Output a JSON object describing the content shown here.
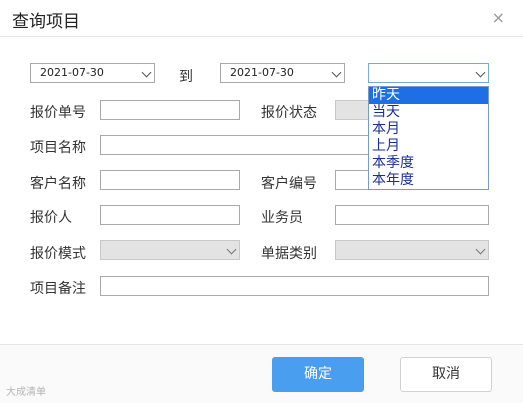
{
  "dialog": {
    "title": "查询项目",
    "close_icon": "×"
  },
  "date_range": {
    "start": "2021-07-30",
    "separator": "到",
    "end": "2021-07-30",
    "period_value": "",
    "period_options": [
      "昨天",
      "当天",
      "本月",
      "上月",
      "本季度",
      "本年度"
    ],
    "highlighted_index": 0
  },
  "fields": {
    "quote_no": "报价单号",
    "quote_status": "报价状态",
    "project_name": "项目名称",
    "customer_name": "客户名称",
    "customer_no": "客户编号",
    "quoter": "报价人",
    "salesperson": "业务员",
    "quote_mode": "报价模式",
    "doc_type": "单据类别",
    "project_note": "项目备注"
  },
  "buttons": {
    "ok": "确定",
    "cancel": "取消"
  },
  "watermark": "大成清单"
}
